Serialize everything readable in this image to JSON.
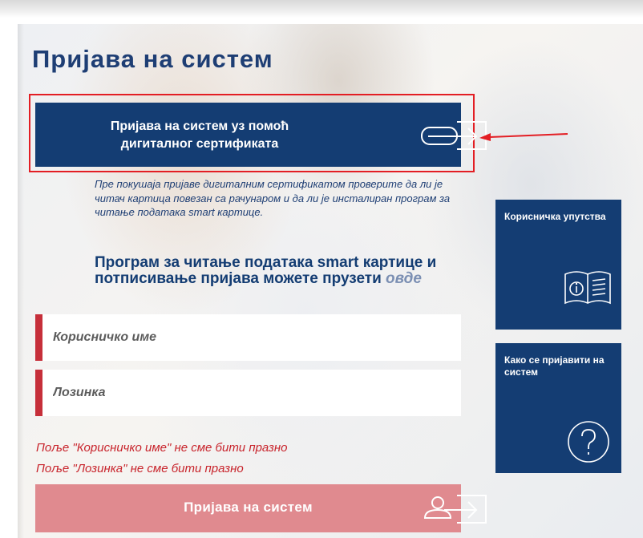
{
  "page": {
    "title": "Пријава на систем"
  },
  "cert_login": {
    "label_line1": "Пријава на систем уз помоћ",
    "label_line2": "дигиталног сертификата",
    "icon": "card-arrow-icon"
  },
  "notice": {
    "text": "Пре покушаја пријаве дигиталним сертификатом проверите да ли је читач картица повезан са рачунаром и да ли је инсталиран програм за читање података smart картице."
  },
  "program": {
    "text": "Програм за читање података smart картице и потписивање пријава можете прузети",
    "link": "овде"
  },
  "form": {
    "username_placeholder": "Корисничко име",
    "password_placeholder": "Лозинка",
    "username_value": "",
    "password_value": ""
  },
  "errors": {
    "username": "Поље \"Корисничко име\" не сме бити празно",
    "password": "Поље \"Лозинка\" не сме бити празно"
  },
  "login_button": {
    "label": "Пријава на систем",
    "icon": "user-arrow-icon"
  },
  "tiles": {
    "manual": {
      "label": "Корисничка упутства",
      "icon": "info-book-icon"
    },
    "howto": {
      "label": "Како се пријавити на систем",
      "icon": "question-circle-icon"
    }
  },
  "colors": {
    "brand_blue": "#143d73",
    "title_blue": "#1e3e74",
    "error_red": "#c8232b",
    "field_accent": "#c62f3a",
    "login_button_disabled": "#e08a8f",
    "highlight_red": "#e31e24"
  }
}
